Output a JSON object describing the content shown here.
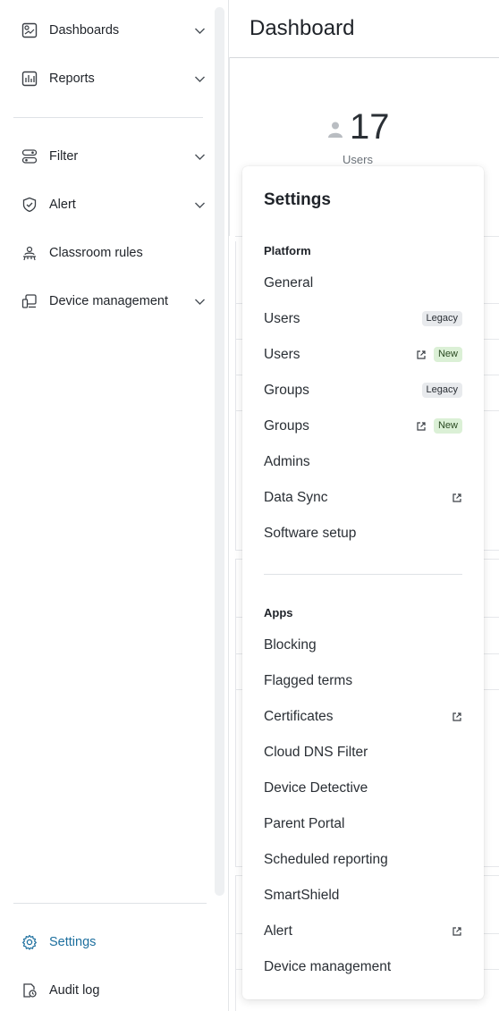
{
  "sidebar": {
    "items": [
      {
        "label": "Dashboards",
        "icon": "dashboards-icon",
        "has_chevron": true
      },
      {
        "label": "Reports",
        "icon": "reports-icon",
        "has_chevron": true
      },
      {
        "label": "Filter",
        "icon": "filter-icon",
        "has_chevron": true
      },
      {
        "label": "Alert",
        "icon": "alert-shield-icon",
        "has_chevron": true
      },
      {
        "label": "Classroom rules",
        "icon": "classroom-icon",
        "has_chevron": false
      },
      {
        "label": "Device management",
        "icon": "device-icon",
        "has_chevron": true
      }
    ],
    "bottom": [
      {
        "label": "Settings",
        "icon": "gear-icon",
        "active": true
      },
      {
        "label": "Audit log",
        "icon": "audit-log-icon",
        "active": false
      }
    ]
  },
  "header": {
    "title": "Dashboard"
  },
  "stat": {
    "value": "17",
    "label": "Users"
  },
  "settings": {
    "title": "Settings",
    "platform_label": "Platform",
    "platform": [
      {
        "label": "General"
      },
      {
        "label": "Users",
        "badge": "Legacy"
      },
      {
        "label": "Users",
        "badge": "New",
        "external": true
      },
      {
        "label": "Groups",
        "badge": "Legacy"
      },
      {
        "label": "Groups",
        "badge": "New",
        "external": true
      },
      {
        "label": "Admins"
      },
      {
        "label": "Data Sync",
        "external": true
      },
      {
        "label": "Software setup"
      }
    ],
    "apps_label": "Apps",
    "apps": [
      {
        "label": "Blocking"
      },
      {
        "label": "Flagged terms"
      },
      {
        "label": "Certificates",
        "external": true
      },
      {
        "label": "Cloud DNS Filter"
      },
      {
        "label": "Device Detective"
      },
      {
        "label": "Parent Portal"
      },
      {
        "label": "Scheduled reporting"
      },
      {
        "label": "SmartShield"
      },
      {
        "label": "Alert",
        "external": true
      },
      {
        "label": "Device management"
      }
    ]
  },
  "colors": {
    "accent": "#1d6f9e",
    "badge_new": "#dbf0d6",
    "badge_legacy": "#e8eaed"
  }
}
